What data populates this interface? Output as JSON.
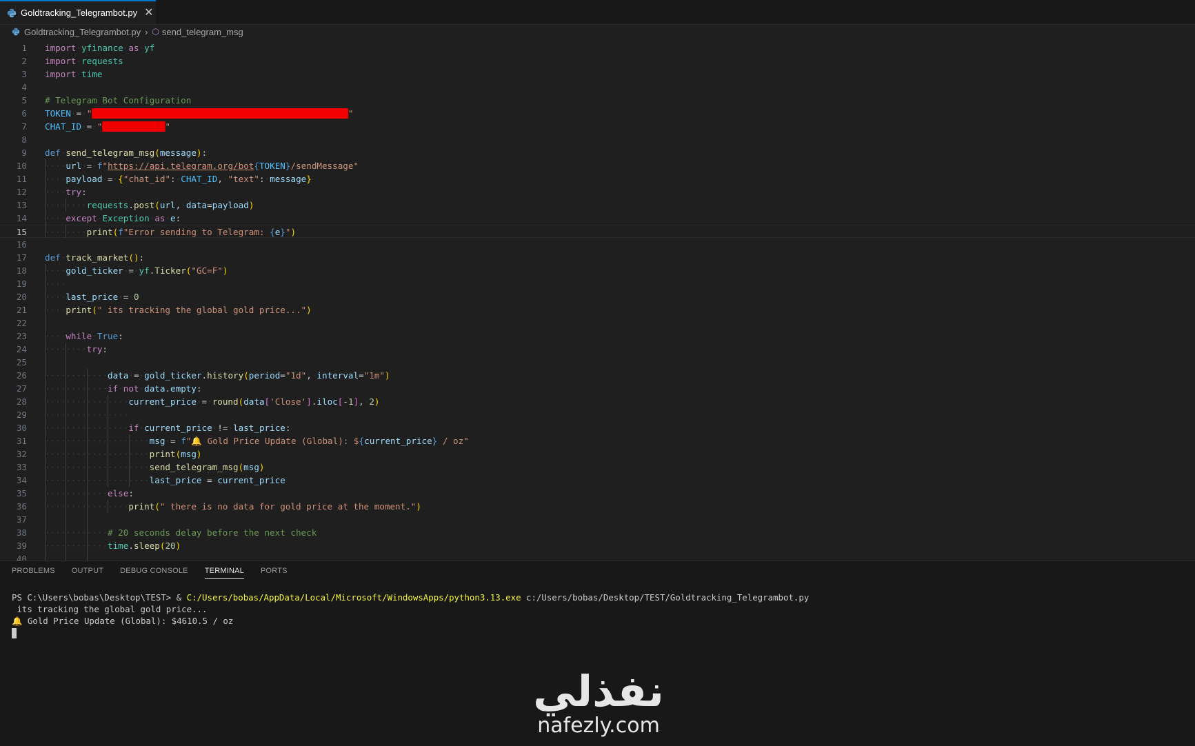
{
  "tab": {
    "title": "Goldtracking_Telegrambot.py",
    "close": "✕",
    "icon": "python-file-icon"
  },
  "breadcrumb": {
    "file": "Goldtracking_Telegrambot.py",
    "separator": "›",
    "symbol": "send_telegram_msg"
  },
  "editor": {
    "current_line": 15
  },
  "panel": {
    "tabs": [
      {
        "label": "PROBLEMS"
      },
      {
        "label": "OUTPUT"
      },
      {
        "label": "DEBUG CONSOLE"
      },
      {
        "label": "TERMINAL"
      },
      {
        "label": "PORTS"
      }
    ],
    "terminal": {
      "prompt": "PS C:\\Users\\bobas\\Desktop\\TEST> & ",
      "exe": "C:/Users/bobas/AppData/Local/Microsoft/WindowsApps/python3.13.exe",
      "script": " c:/Users/bobas/Desktop/TEST/Goldtracking_Telegrambot.py",
      "out1": " its tracking the global gold price...",
      "out2": "🔔 Gold Price Update (Global): $4610.5 / oz"
    }
  },
  "watermark": {
    "arabic": "نفذلي",
    "latin": "nafezly.com"
  },
  "code_lines": [
    "import yfinance as yf",
    "import requests",
    "import time",
    "",
    "# Telegram Bot Configuration",
    "TOKEN = \"█████████████████████████████████████████████████\"",
    "CHAT_ID = \"████████████\"",
    "",
    "def send_telegram_msg(message):",
    "    url = f\"https://api.telegram.org/bot{TOKEN}/sendMessage\"",
    "    payload = {\"chat_id\": CHAT_ID, \"text\": message}",
    "    try:",
    "        requests.post(url, data=payload)",
    "    except Exception as e:",
    "        print(f\"Error sending to Telegram: {e}\")",
    "",
    "def track_market():",
    "    gold_ticker = yf.Ticker(\"GC=F\")",
    "    ",
    "    last_price = 0",
    "    print(\" its tracking the global gold price...\")",
    "",
    "    while True:",
    "        try:",
    "",
    "            data = gold_ticker.history(period=\"1d\", interval=\"1m\")",
    "            if not data.empty:",
    "                current_price = round(data['Close'].iloc[-1], 2)",
    "                ",
    "                if current_price != last_price:",
    "                    msg = f\"🔔 Gold Price Update (Global): ${current_price} / oz\"",
    "                    print(msg)",
    "                    send_telegram_msg(msg)",
    "                    last_price = current_price",
    "            else:",
    "                print(\" there is no data for gold price at the moment.\")",
    "",
    "            # 20 seconds delay before the next check",
    "            time.sleep(20)",
    ""
  ]
}
